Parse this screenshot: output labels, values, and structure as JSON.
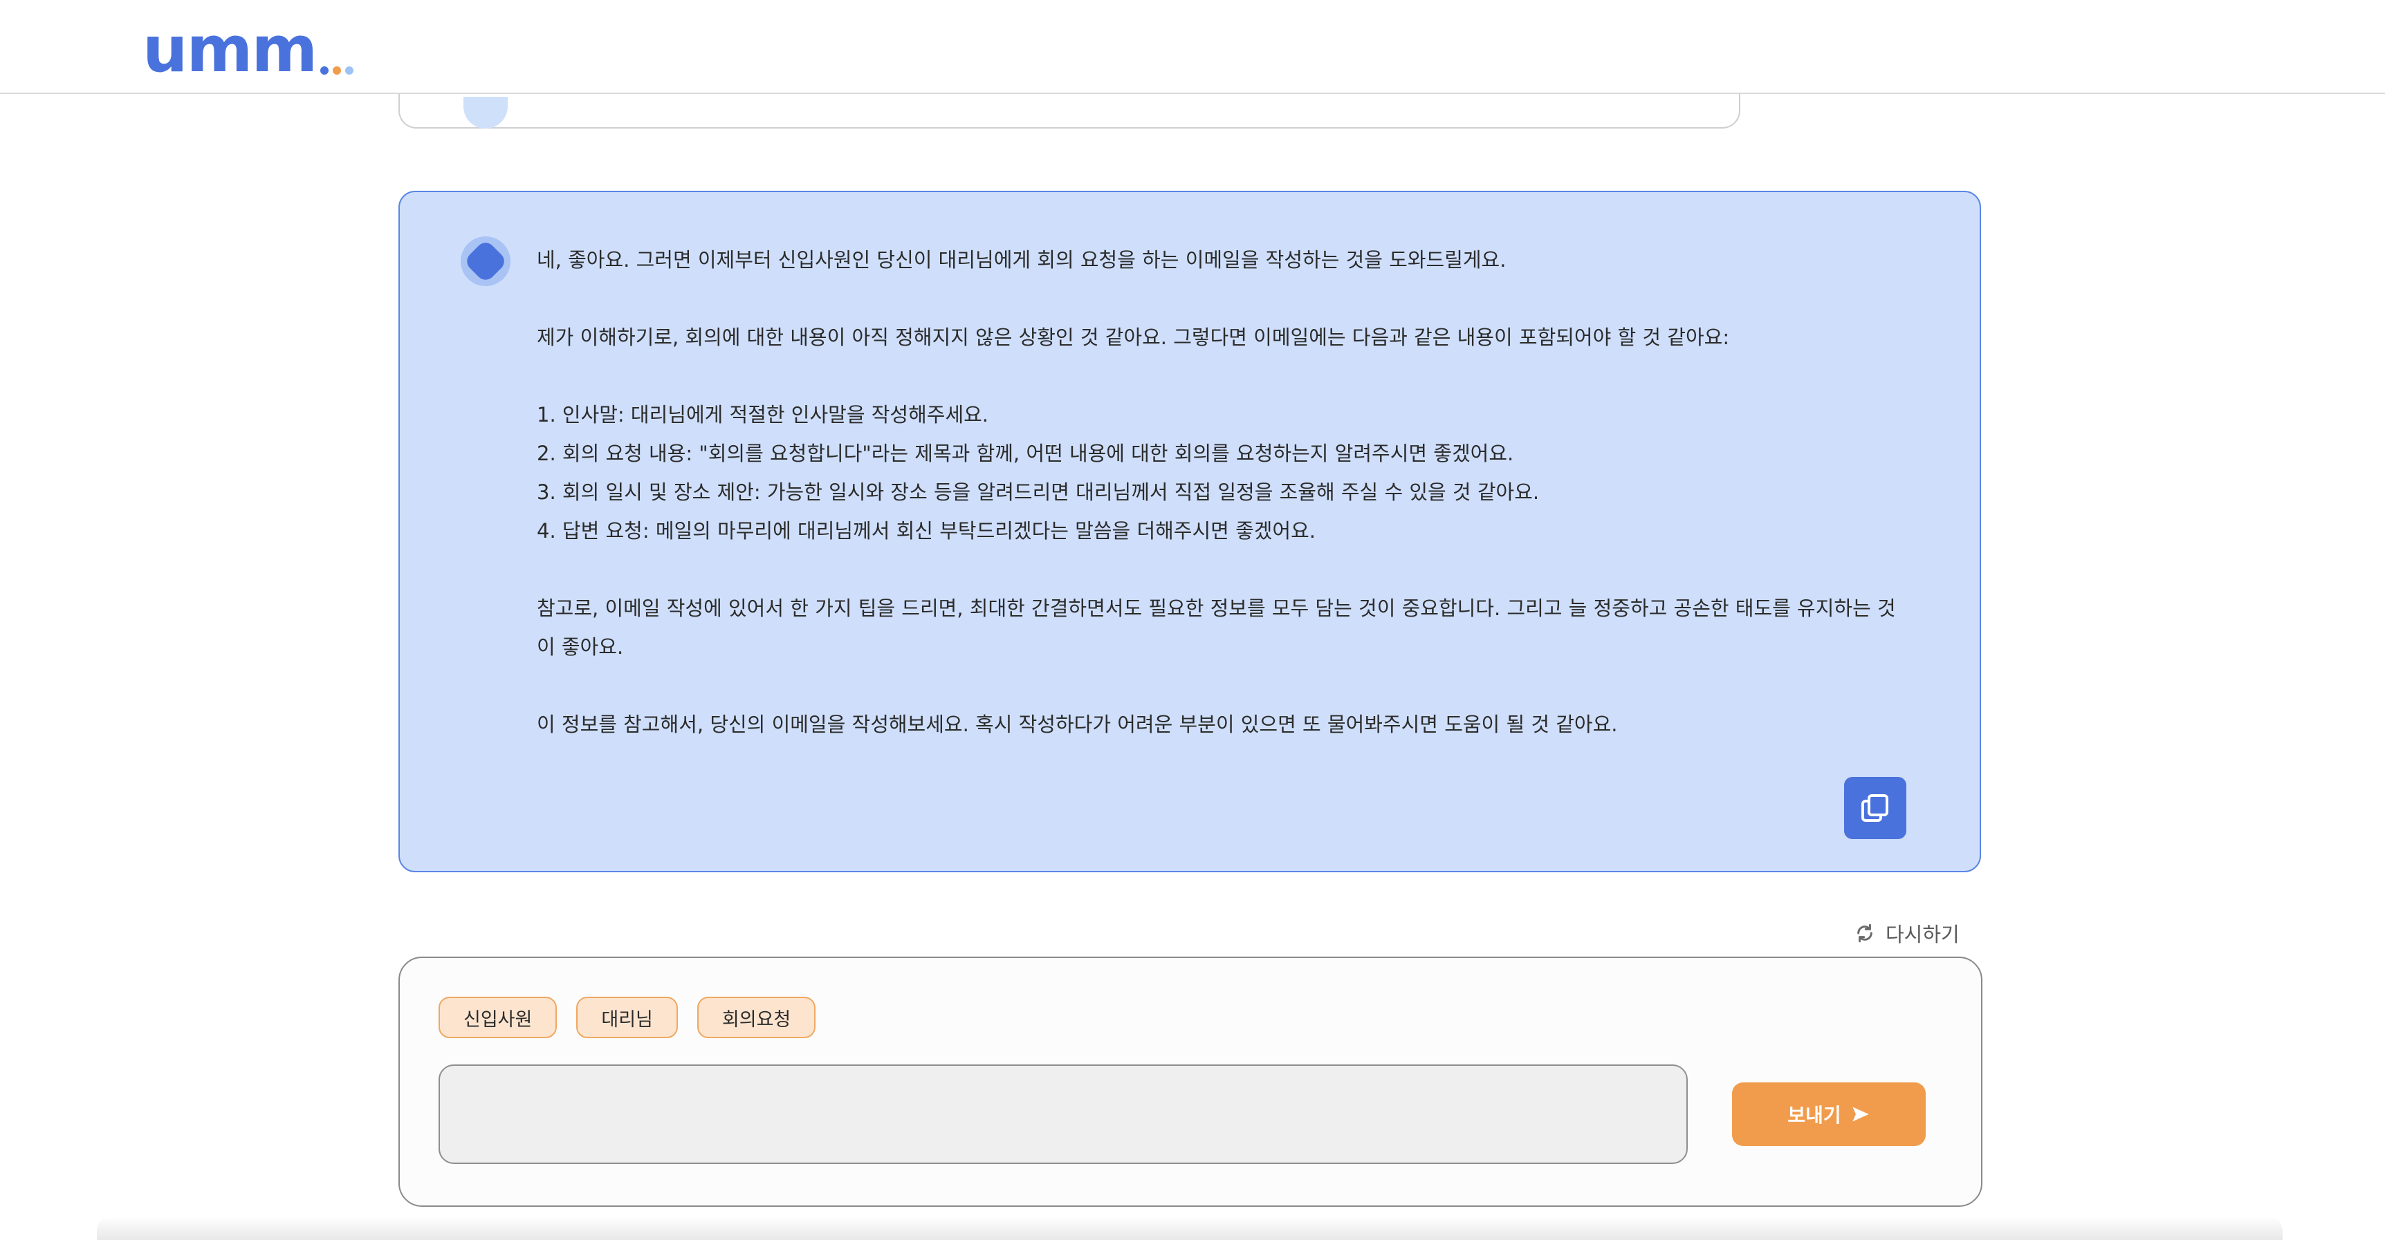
{
  "app": {
    "logo_text": "umm",
    "logo_dot_colors": [
      "#4a72dc",
      "#f19c4c",
      "#9ec2f5"
    ]
  },
  "colors": {
    "accent": "#4a72dc",
    "answer_bg": "#cfdffb",
    "send_button": "#f19c4c",
    "chip_bg": "#fce4cf"
  },
  "answer": {
    "paragraphs": [
      "네, 좋아요. 그러면 이제부터 신입사원인 당신이 대리님에게 회의 요청을 하는 이메일을 작성하는 것을 도와드릴게요.",
      "제가 이해하기로, 회의에 대한 내용이 아직 정해지지 않은 상황인 것 같아요. 그렇다면 이메일에는 다음과 같은 내용이 포함되어야 할 것 같아요:",
      "1. 인사말: 대리님에게 적절한 인사말을 작성해주세요.",
      "2. 회의 요청 내용: \"회의를 요청합니다\"라는 제목과 함께, 어떤 내용에 대한 회의를 요청하는지 알려주시면 좋겠어요.",
      "3. 회의 일시 및 장소 제안: 가능한 일시와 장소 등을 알려드리면 대리님께서 직접 일정을 조율해 주실 수 있을 것 같아요.",
      "4. 답변 요청: 메일의 마무리에 대리님께서 회신 부탁드리겠다는 말씀을 더해주시면 좋겠어요.",
      "참고로, 이메일 작성에 있어서 한 가지 팁을 드리면, 최대한 간결하면서도 필요한 정보를 모두 담는 것이 중요합니다. 그리고 늘 정중하고 공손한 태도를 유지하는 것이 좋아요.",
      "이 정보를 참고해서, 당신의 이메일을 작성해보세요. 혹시 작성하다가 어려운 부분이 있으면 또 물어봐주시면 도움이 될 것 같아요."
    ],
    "copy_icon": "copy-icon",
    "bot_icon": "bot-gem-icon"
  },
  "actions": {
    "retry_label": "다시하기",
    "retry_icon": "refresh-icon"
  },
  "composer": {
    "chips": [
      "신입사원",
      "대리님",
      "회의요청"
    ],
    "input_value": "",
    "input_placeholder": "",
    "send_label": "보내기",
    "send_icon": "send-arrow-icon"
  }
}
